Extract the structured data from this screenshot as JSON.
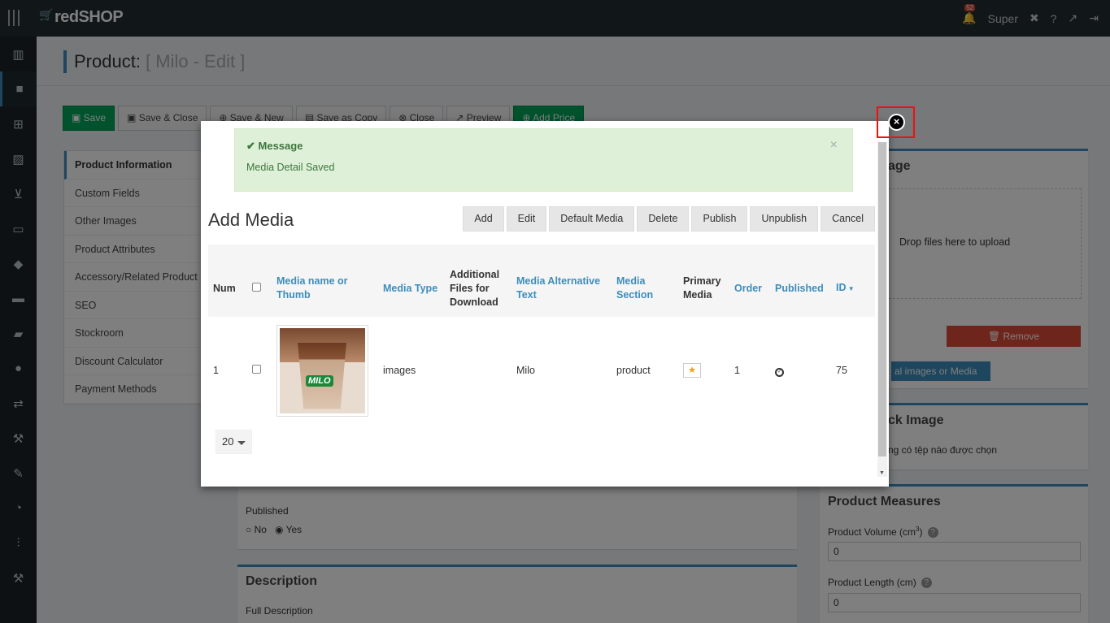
{
  "topbar": {
    "logo": "redSHOP",
    "notif_count": "52",
    "user": "Super"
  },
  "page": {
    "title": "Product:",
    "subtitle": "[ Milo - Edit ]"
  },
  "toolbar": {
    "save": "Save",
    "save_close": "Save & Close",
    "save_new": "Save & New",
    "save_copy": "Save as Copy",
    "close": "Close",
    "preview": "Preview",
    "add_price": "Add Price"
  },
  "leftnav": [
    "Product Information",
    "Custom Fields",
    "Other Images",
    "Product Attributes",
    "Accessory/Related Product",
    "SEO",
    "Stockroom",
    "Discount Calculator",
    "Payment Methods"
  ],
  "right": {
    "image_title": "age",
    "drop_text": "Drop files here to upload",
    "remove": "Remove",
    "additional_media": "al images or Media",
    "back_image": "ck Image",
    "no_file": "ng có tệp nào được chọn",
    "measures_title": "Product Measures",
    "volume_label": "Product Volume (cm",
    "volume_sup": "3",
    "volume_label_end": ")",
    "volume_value": "0",
    "length_label": "Product Length (cm)",
    "length_value": "0"
  },
  "center": {
    "published_label": "Published",
    "no": "No",
    "yes": "Yes",
    "desc_title": "Description",
    "full_desc": "Full Description"
  },
  "modal": {
    "message_head": "Message",
    "message_body": "Media Detail Saved",
    "title": "Add Media",
    "buttons": {
      "add": "Add",
      "edit": "Edit",
      "default_media": "Default Media",
      "delete": "Delete",
      "publish": "Publish",
      "unpublish": "Unpublish",
      "cancel": "Cancel"
    },
    "headers": {
      "num": "Num",
      "name": "Media name or Thumb",
      "type": "Media Type",
      "additional": "Additional Files for Download",
      "alt": "Media Alternative Text",
      "section": "Media Section",
      "primary": "Primary Media",
      "order": "Order",
      "published": "Published",
      "id": "ID"
    },
    "row": {
      "num": "1",
      "type": "images",
      "alt": "Milo",
      "section": "product",
      "order": "1",
      "id": "75",
      "thumb_text": "MILO"
    },
    "limit": "20"
  },
  "colors": {
    "accent": "#3c8dbc",
    "topbar": "#222d32",
    "success_bg": "#dff0d8",
    "close_highlight": "#ee1111"
  }
}
